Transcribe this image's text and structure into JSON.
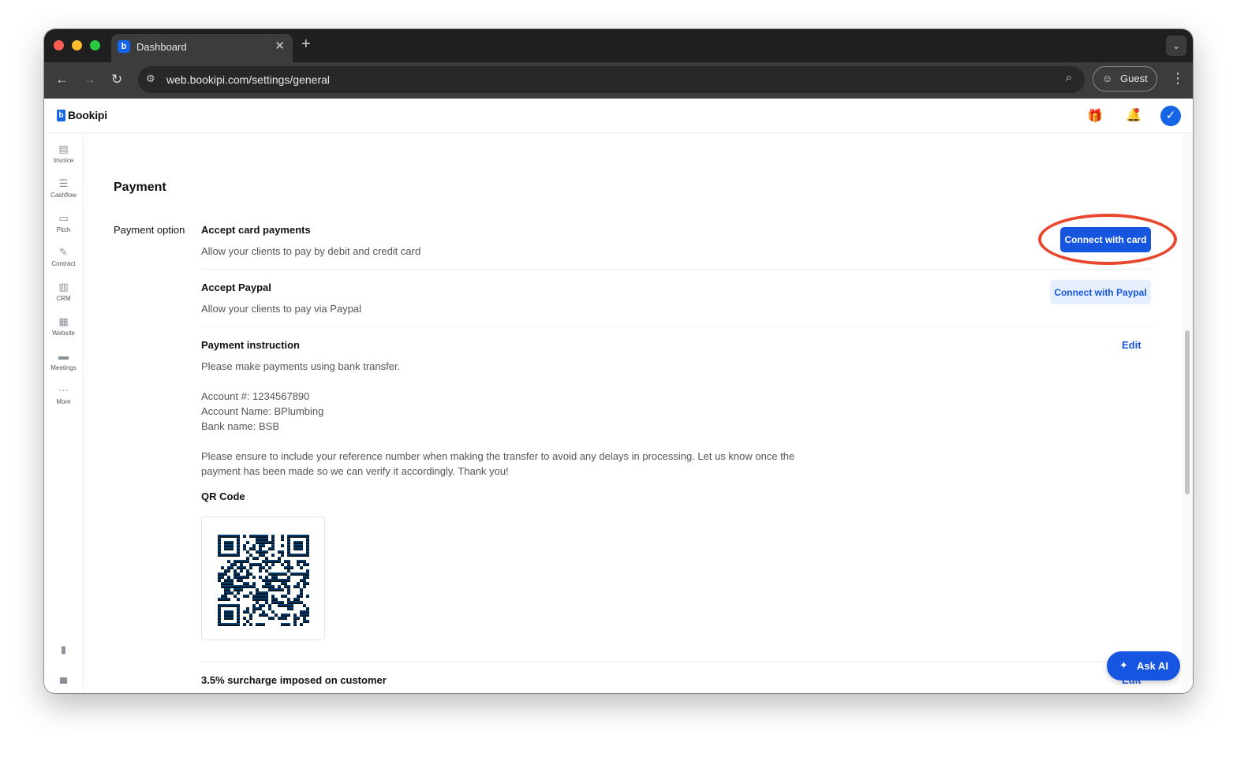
{
  "browser": {
    "tab_title": "Dashboard",
    "url": "web.bookipi.com/settings/general",
    "profile_label": "Guest"
  },
  "app": {
    "brand": "Bookipi",
    "sidebar": [
      {
        "label": "Invoice",
        "icon": "invoice-icon"
      },
      {
        "label": "Cashflow",
        "icon": "cashflow-icon"
      },
      {
        "label": "Pitch",
        "icon": "pitch-icon"
      },
      {
        "label": "Contract",
        "icon": "contract-icon"
      },
      {
        "label": "CRM",
        "icon": "crm-icon"
      },
      {
        "label": "Website",
        "icon": "website-icon"
      },
      {
        "label": "Meetings",
        "icon": "meetings-icon"
      },
      {
        "label": "More",
        "icon": "more-icon"
      }
    ],
    "sidebar_bottom_icons": [
      "reports-icon",
      "bank-icon"
    ]
  },
  "payment": {
    "section_title": "Payment",
    "row_label": "Payment option",
    "card": {
      "title": "Accept card payments",
      "description": "Allow your clients to pay by debit and credit card",
      "button": "Connect with card"
    },
    "paypal": {
      "title": "Accept Paypal",
      "description": "Allow your clients to pay via Paypal",
      "button": "Connect with Paypal"
    },
    "instruction": {
      "title": "Payment instruction",
      "edit": "Edit",
      "line1": "Please make payments using bank transfer.",
      "account_number": "Account #: 1234567890",
      "account_name": "Account Name: BPlumbing",
      "bank_name": "Bank name: BSB",
      "note_line1": "Please ensure to include your reference number when making the transfer to avoid any delays in processing. Let us know once the",
      "note_line2": "payment has been made so we can verify it accordingly. Thank you!"
    },
    "qr_title": "QR Code",
    "surcharge": {
      "title": "3.5% surcharge imposed on customer",
      "edit": "Edit"
    }
  },
  "ask_ai": "Ask AI",
  "colors": {
    "primary": "#1655e0",
    "highlight": "#e8472e",
    "secondary_bg": "#e6effd"
  }
}
